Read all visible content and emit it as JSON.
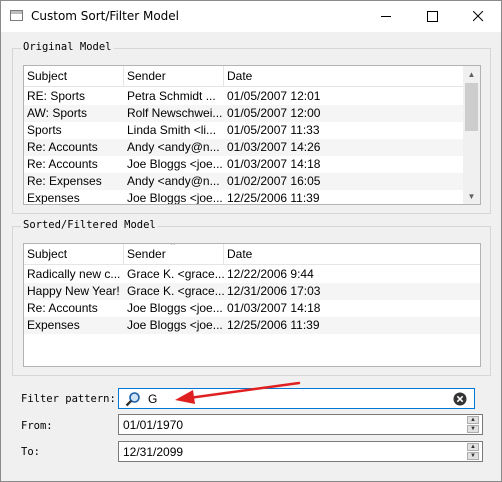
{
  "window": {
    "title": "Custom Sort/Filter Model",
    "minimize_icon": "minimize-icon",
    "maximize_icon": "maximize-icon",
    "close_icon": "close-icon"
  },
  "original": {
    "group_title": "Original Model",
    "headers": [
      "Subject",
      "Sender",
      "Date"
    ],
    "rows": [
      [
        "RE: Sports",
        "Petra Schmidt ...",
        "01/05/2007 12:01"
      ],
      [
        "AW: Sports",
        "Rolf Newschwei...",
        "01/05/2007 12:00"
      ],
      [
        "Sports",
        "Linda Smith <li...",
        "01/05/2007 11:33"
      ],
      [
        "Re: Accounts",
        "Andy <andy@n...",
        "01/03/2007 14:26"
      ],
      [
        "Re: Accounts",
        "Joe Bloggs <joe...",
        "01/03/2007 14:18"
      ],
      [
        "Re: Expenses",
        "Andy <andy@n...",
        "01/02/2007 16:05"
      ],
      [
        "Expenses",
        "Joe Bloggs <joe...",
        "12/25/2006 11:39"
      ]
    ]
  },
  "sorted": {
    "group_title": "Sorted/Filtered Model",
    "headers": [
      "Subject",
      "Sender",
      "Date"
    ],
    "sort_indicator": "^",
    "rows": [
      [
        "Radically new c...",
        "Grace K. <grace...",
        "12/22/2006 9:44"
      ],
      [
        "Happy New Year!",
        "Grace K. <grace...",
        "12/31/2006 17:03"
      ],
      [
        "Re: Accounts",
        "Joe Bloggs <joe...",
        "01/03/2007 14:18"
      ],
      [
        "Expenses",
        "Joe Bloggs <joe...",
        "12/25/2006 11:39"
      ]
    ]
  },
  "filter": {
    "label": "Filter pattern:",
    "value": "G",
    "search_icon": "search-icon",
    "clear_icon": "clear-icon"
  },
  "from": {
    "label": "From:",
    "value": "01/01/1970"
  },
  "to": {
    "label": "To:",
    "value": "12/31/2099"
  },
  "annotation": {
    "arrow_color": "#e02020"
  }
}
